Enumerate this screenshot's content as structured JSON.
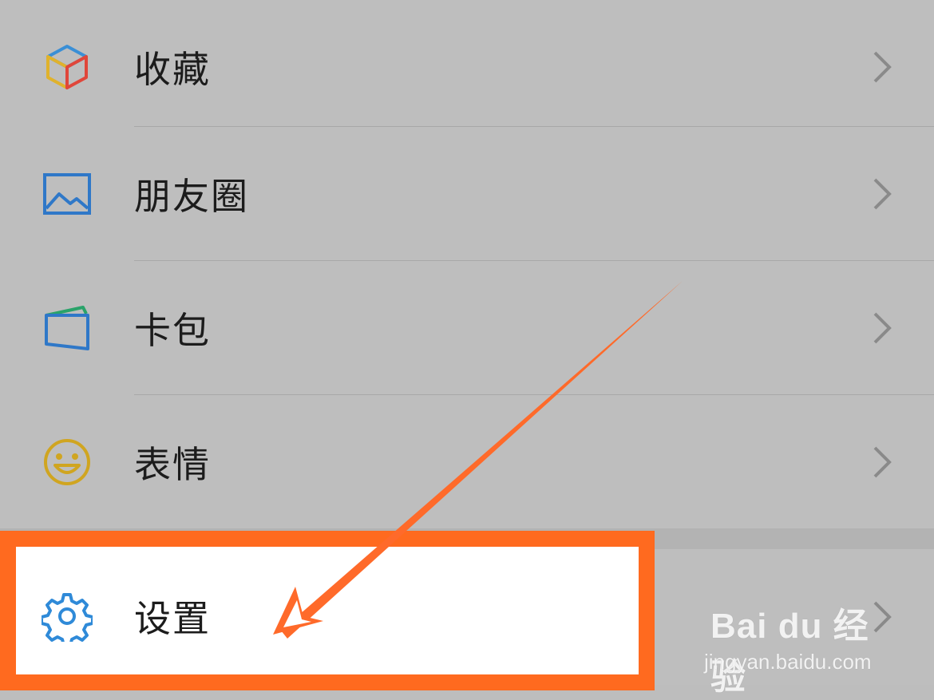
{
  "menu": {
    "items": [
      {
        "label": "收藏",
        "icon": "favorites-cube-icon"
      },
      {
        "label": "朋友圈",
        "icon": "moments-image-icon"
      },
      {
        "label": "卡包",
        "icon": "card-wallet-icon"
      },
      {
        "label": "表情",
        "icon": "smiley-face-icon"
      }
    ],
    "settings": {
      "label": "设置",
      "icon": "gear-icon"
    }
  },
  "watermark": {
    "brand": "Bai du 经验",
    "url": "jingyan.baidu.com"
  },
  "colors": {
    "highlight": "#ff6a1f",
    "arrow": "#ff6a2a",
    "settings_icon": "#2f8ad8"
  }
}
